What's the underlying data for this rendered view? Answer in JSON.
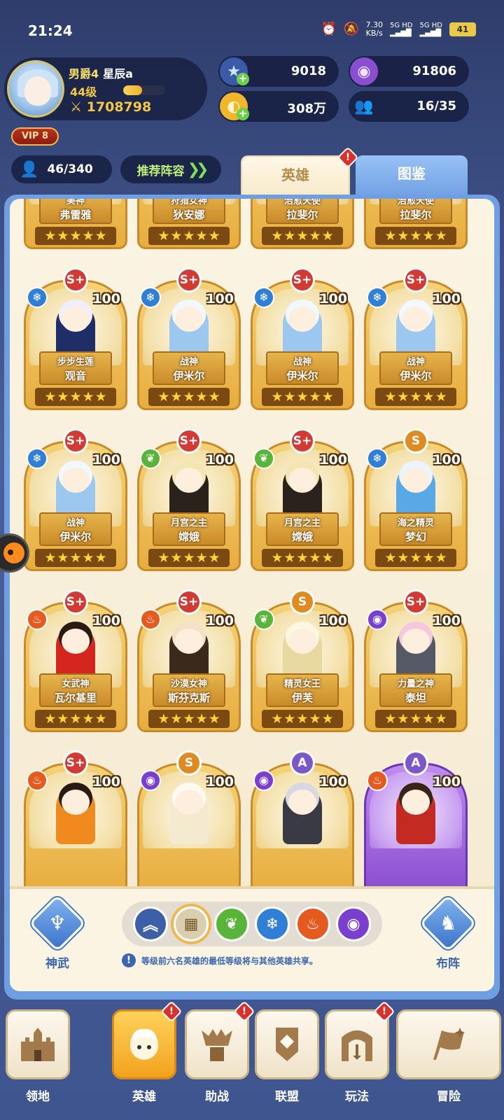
{
  "status": {
    "time": "21:24",
    "net_speed_value": "7.30",
    "net_speed_unit": "KB/s",
    "signal1": "5G HD",
    "signal2": "5G HD",
    "battery": "41"
  },
  "player": {
    "rank": "男爵4",
    "name": "星辰a",
    "level": "44级",
    "exp_progress": 0.45,
    "power": "1708798",
    "vip": "VIP 8"
  },
  "resources": {
    "stars": "9018",
    "gems": "91806",
    "gold": "308万",
    "team": "16/35"
  },
  "hero_count": "46/340",
  "recommend_label": "推荐阵容",
  "tabs": {
    "heroes": "英雄",
    "codex": "图鉴"
  },
  "heroes": [
    {
      "title": "美神",
      "name": "弗雷雅",
      "rarity": "",
      "element": "",
      "level": "",
      "stars": 5,
      "palette": "nature"
    },
    {
      "title": "狩猎女神",
      "name": "狄安娜",
      "rarity": "",
      "element": "",
      "level": "",
      "stars": 5,
      "palette": "nature"
    },
    {
      "title": "治愈天使",
      "name": "拉斐尔",
      "rarity": "",
      "element": "",
      "level": "",
      "stars": 5,
      "palette": "light"
    },
    {
      "title": "治愈天使",
      "name": "拉斐尔",
      "rarity": "",
      "element": "",
      "level": "",
      "stars": 5,
      "palette": "light"
    },
    {
      "title": "步步生莲",
      "name": "观音",
      "rarity": "S+",
      "element": "ice",
      "level": "100",
      "stars": 5,
      "palette": "dark"
    },
    {
      "title": "战神",
      "name": "伊米尔",
      "rarity": "S+",
      "element": "ice",
      "level": "100",
      "stars": 5,
      "palette": "ice"
    },
    {
      "title": "战神",
      "name": "伊米尔",
      "rarity": "S+",
      "element": "ice",
      "level": "100",
      "stars": 5,
      "palette": "ice"
    },
    {
      "title": "战神",
      "name": "伊米尔",
      "rarity": "S+",
      "element": "ice",
      "level": "100",
      "stars": 5,
      "palette": "ice"
    },
    {
      "title": "战神",
      "name": "伊米尔",
      "rarity": "S+",
      "element": "ice",
      "level": "100",
      "stars": 5,
      "palette": "ice"
    },
    {
      "title": "月宫之主",
      "name": "嫦娥",
      "rarity": "S+",
      "element": "nature",
      "level": "100",
      "stars": 5,
      "palette": "moon"
    },
    {
      "title": "月宫之主",
      "name": "嫦娥",
      "rarity": "S+",
      "element": "nature",
      "level": "100",
      "stars": 5,
      "palette": "moon"
    },
    {
      "title": "海之精灵",
      "name": "梦幻",
      "rarity": "S",
      "element": "ice",
      "level": "100",
      "stars": 5,
      "palette": "sea"
    },
    {
      "title": "女武神",
      "name": "瓦尔基里",
      "rarity": "S+",
      "element": "fire",
      "level": "100",
      "stars": 5,
      "palette": "fire"
    },
    {
      "title": "沙漠女神",
      "name": "斯芬克斯",
      "rarity": "S+",
      "element": "fire",
      "level": "100",
      "stars": 5,
      "palette": "desert"
    },
    {
      "title": "精灵女王",
      "name": "伊芙",
      "rarity": "S",
      "element": "nature",
      "level": "100",
      "stars": 5,
      "palette": "elf"
    },
    {
      "title": "力量之神",
      "name": "泰坦",
      "rarity": "S+",
      "element": "spirit",
      "level": "100",
      "stars": 5,
      "palette": "titan"
    },
    {
      "title": "",
      "name": "",
      "rarity": "S+",
      "element": "fire",
      "level": "100",
      "stars": 0,
      "palette": "lava"
    },
    {
      "title": "",
      "name": "",
      "rarity": "S",
      "element": "spirit",
      "level": "100",
      "stars": 0,
      "palette": "angel"
    },
    {
      "title": "",
      "name": "",
      "rarity": "A",
      "element": "spirit",
      "level": "100",
      "stars": 0,
      "palette": "ninja"
    },
    {
      "title": "",
      "name": "",
      "rarity": "A",
      "element": "fire",
      "level": "100",
      "stars": 0,
      "palette": "witch"
    }
  ],
  "controls": {
    "left_label": "神武",
    "right_label": "布阵",
    "notice": "等级前六名英雄的最低等级将与其他英雄共享。",
    "filters": [
      "sort",
      "all",
      "nature",
      "ice",
      "fire",
      "spirit"
    ]
  },
  "nav": [
    {
      "label": "领地",
      "icon": "castle-icon",
      "badge": false,
      "active": false
    },
    {
      "label": "英雄",
      "icon": "hero-icon",
      "badge": true,
      "active": true
    },
    {
      "label": "助战",
      "icon": "support-icon",
      "badge": true,
      "active": false
    },
    {
      "label": "联盟",
      "icon": "alliance-icon",
      "badge": false,
      "active": false
    },
    {
      "label": "玩法",
      "icon": "gameplay-icon",
      "badge": true,
      "active": false
    },
    {
      "label": "冒险",
      "icon": "adventure-icon",
      "badge": false,
      "active": false
    }
  ],
  "colors": {
    "accent": "#6f9ee2",
    "gold": "#f5c742",
    "card": "#e7ad3e",
    "card_purple": "#8a4fd0"
  }
}
